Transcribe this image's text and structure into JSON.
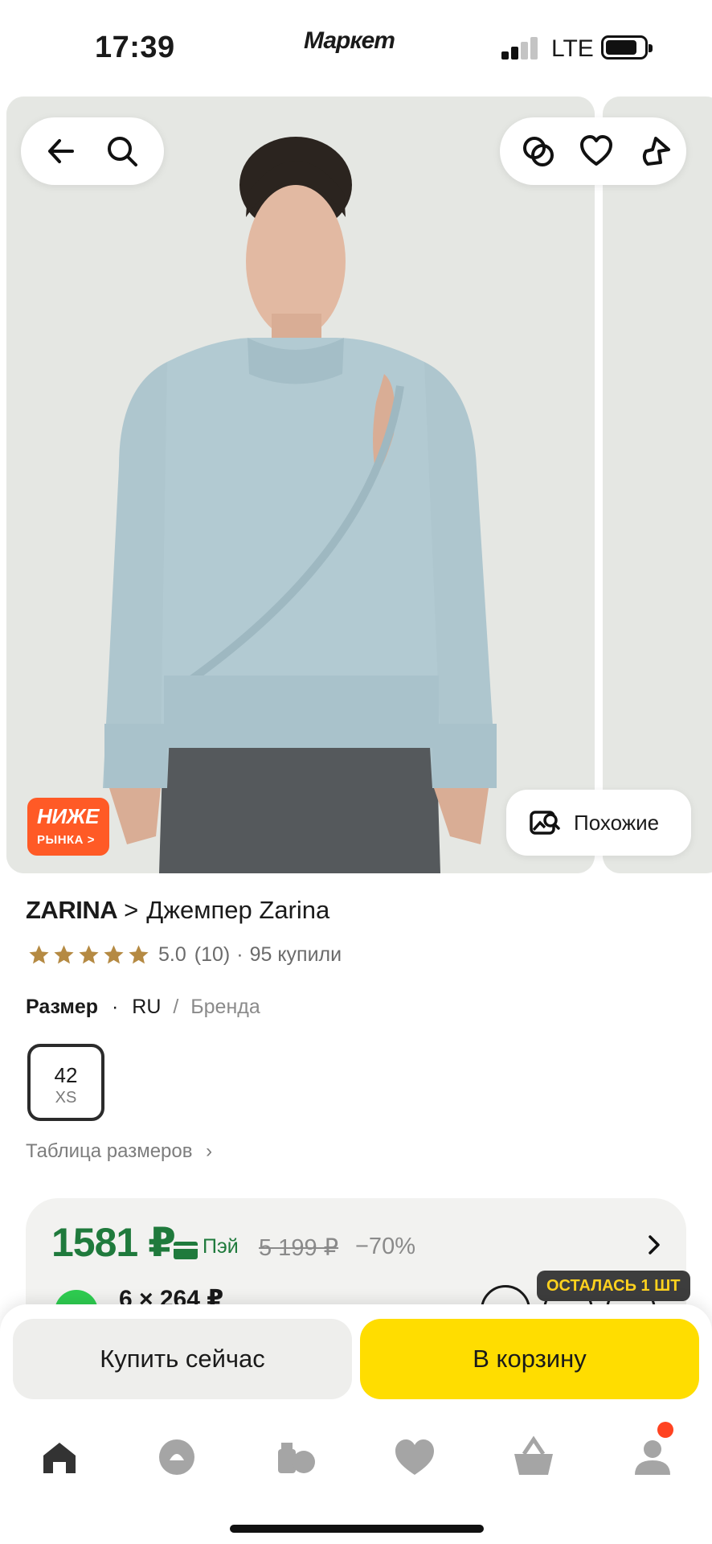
{
  "status_bar": {
    "time": "17:39",
    "app_brand": "Маркет",
    "network": "LTE",
    "signal_bars_active": 2,
    "signal_bars_total": 4
  },
  "gallery": {
    "back_icon": "arrow-left-icon",
    "search_icon": "search-icon",
    "compare_icon": "compare-icon",
    "favorite_icon": "heart-icon",
    "share_icon": "share-icon",
    "promo_badge": {
      "line1": "НИЖЕ",
      "line2": "РЫНКА",
      "chevron": ">"
    },
    "similar_button": {
      "label": "Похожие",
      "icon": "image-search-icon"
    },
    "colors": {
      "background": "#e6e8e5",
      "sweater": "#aec6ce",
      "pants": "#55595c",
      "promo": "#ff5a26"
    }
  },
  "product": {
    "brand": "ZARINA",
    "breadcrumb_separator": ">",
    "name": "Джемпер Zarina",
    "rating": "5.0",
    "reviews": "(10)",
    "purchases": "95 купили",
    "stars": 5,
    "star_color": "#b58a43"
  },
  "size": {
    "label": "Размер",
    "system_selected": "RU",
    "system_other": "Бренда",
    "selected_value": "42",
    "selected_sub": "XS",
    "table_link": "Таблица размеров"
  },
  "price": {
    "current": "1581 ₽",
    "payment_label": "Пэй",
    "old": "5 199 ₽",
    "discount": "−70%",
    "installment": "6 × 264 ₽",
    "price_color": "#1f7a3c"
  },
  "stock_badge": "ОСТАЛАСЬ 1 ШТ",
  "actions": {
    "buy_now": "Купить сейчас",
    "add_to_cart": "В корзину",
    "cart_color": "#ffdd00"
  },
  "tabbar": {
    "items": [
      "home-icon",
      "alice-icon",
      "catalog-icon",
      "favorites-icon",
      "cart-icon",
      "profile-icon"
    ],
    "profile_has_notification": true
  }
}
